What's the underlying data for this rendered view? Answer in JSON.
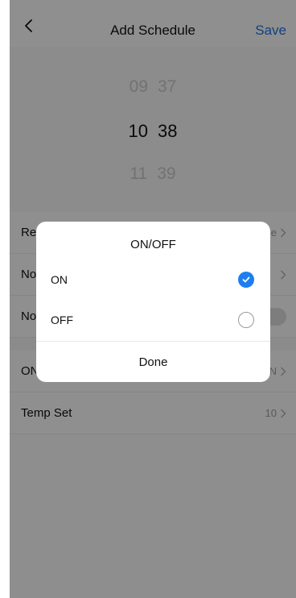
{
  "header": {
    "title": "Add Schedule",
    "save_label": "Save",
    "back_icon": "chevron-left-icon"
  },
  "picker": {
    "rows": [
      {
        "hour": "09",
        "minute": "37"
      },
      {
        "hour": "10",
        "minute": "38"
      },
      {
        "hour": "11",
        "minute": "39"
      }
    ]
  },
  "settings": {
    "repeat_label": "Re",
    "repeat_value": "e",
    "notify1_label": "No",
    "notify2_label": "No",
    "onoff_label": "ON",
    "onoff_value": "N",
    "temp_label": "Temp Set",
    "temp_value": "10"
  },
  "dialog": {
    "title": "ON/OFF",
    "options": [
      {
        "label": "ON",
        "selected": true
      },
      {
        "label": "OFF",
        "selected": false
      }
    ],
    "done_label": "Done"
  },
  "colors": {
    "accent": "#1e7ef0",
    "save_link": "#1e6fd9"
  }
}
